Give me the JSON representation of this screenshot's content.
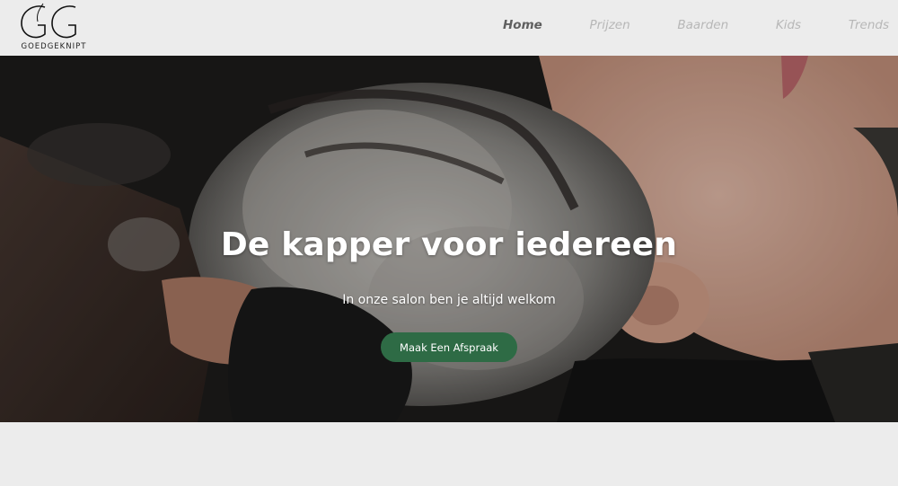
{
  "brand": {
    "name": "GOEDGEKNIPT",
    "monogram": "GG"
  },
  "nav": {
    "items": [
      {
        "label": "Home",
        "active": true
      },
      {
        "label": "Prijzen",
        "active": false
      },
      {
        "label": "Baarden",
        "active": false
      },
      {
        "label": "Kids",
        "active": false
      },
      {
        "label": "Trends",
        "active": false
      }
    ]
  },
  "hero": {
    "title": "De kapper voor iedereen",
    "subtitle": "In onze salon ben je altijd welkom",
    "cta_label": "Maak Een Afspraak",
    "image_subject": "hair-wash-photo"
  },
  "colors": {
    "header_bg": "#ececec",
    "nav_active": "#5f5f5f",
    "nav_inactive": "#b7b7b7",
    "cta_bg": "#2e6b45",
    "text_light": "#ffffff"
  }
}
